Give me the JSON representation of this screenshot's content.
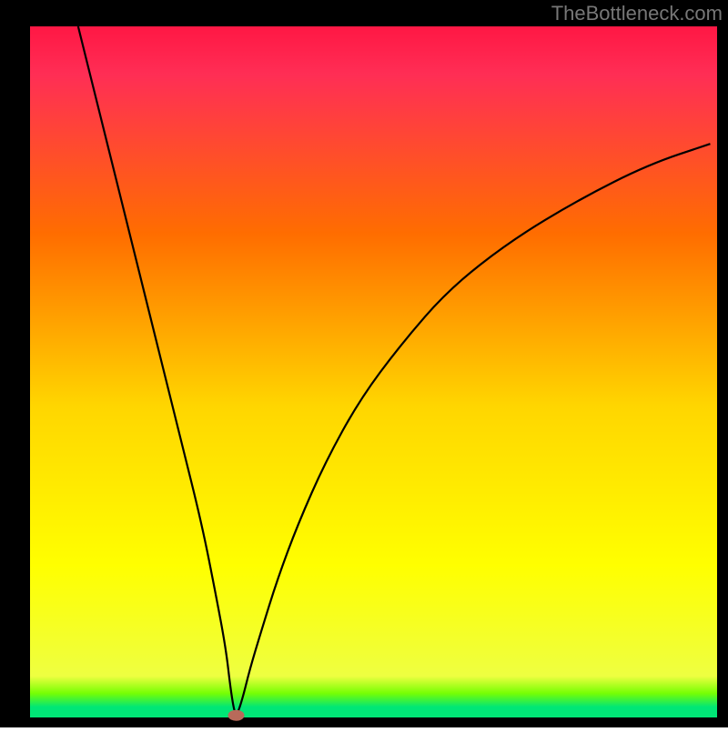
{
  "header": {
    "watermark": "TheBottleneck.com"
  },
  "chart_data": {
    "type": "line",
    "title": "",
    "xlabel": "",
    "ylabel": "",
    "xlim": [
      0,
      100
    ],
    "ylim": [
      0,
      100
    ],
    "background": {
      "type": "vertical-gradient",
      "top_color": "#ff1744",
      "mid_upper_color": "#ff6d00",
      "mid_color": "#ffd600",
      "mid_lower_color": "#ffff00",
      "bottom_thin": "#76ff03",
      "bottom_color": "#00e676"
    },
    "series": [
      {
        "name": "bottleneck-curve",
        "color": "#000000",
        "stroke_width": 2.2,
        "x": [
          7,
          10,
          13,
          16,
          19,
          22,
          25,
          27,
          28.5,
          29.2,
          29.8,
          30.2,
          31,
          32,
          33.5,
          36,
          39,
          43,
          48,
          54,
          61,
          70,
          80,
          90,
          99
        ],
        "y": [
          100,
          88,
          76,
          64,
          52,
          40,
          28,
          18,
          10,
          4,
          0.5,
          0.5,
          3,
          7,
          12,
          20,
          28,
          37,
          46,
          54,
          62,
          69,
          75,
          80,
          83
        ]
      }
    ],
    "marker": {
      "name": "min-point",
      "x": 30,
      "y": 0.3,
      "color": "#b86a5a",
      "rx": 9,
      "ry": 6
    },
    "frame": {
      "color": "#000000",
      "left_width": 33,
      "right_width": 12,
      "top_width": 29,
      "bottom_width": 11
    }
  }
}
